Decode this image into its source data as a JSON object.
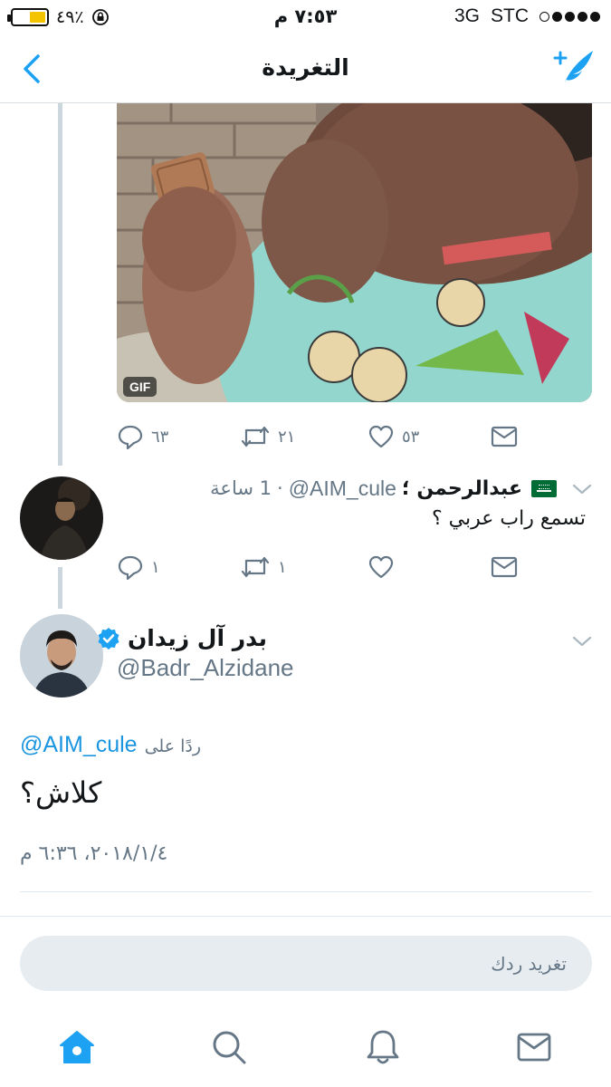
{
  "status_bar": {
    "battery_percent": "٤٩٪",
    "battery_level": 0.49,
    "time": "٧:٥٣ م",
    "network": "3G",
    "carrier": "STC"
  },
  "nav": {
    "title": "التغريدة"
  },
  "previous_tweet": {
    "media_badge": "GIF",
    "reply_count": "٦٣",
    "retweet_count": "٢١",
    "like_count": "٥٣"
  },
  "reply_tweet": {
    "name": "عبدالرحمن ؛",
    "handle": "@AIM_cule",
    "time": "1 ساعة",
    "separator": "·",
    "text": "تسمع راب عربي ؟",
    "reply_count": "١",
    "retweet_count": "١"
  },
  "main_tweet": {
    "name": "بدر آل زيدان",
    "handle": "@Badr_Alzidane",
    "replying_to_label": "ردًا على",
    "replying_to_handle": "@AIM_cule",
    "text": "كلاش؟",
    "timestamp": "٢٠١٨/١/٤، ٦:٣٦ م"
  },
  "composer": {
    "placeholder": "تغريد ردك"
  },
  "colors": {
    "accent": "#1da1f2",
    "secondary_text": "#657786",
    "thread_line": "#ccd6dd"
  },
  "icons": [
    "back-chevron-icon",
    "compose-tweet-icon",
    "reply-icon",
    "retweet-icon",
    "like-icon",
    "direct-message-icon",
    "home-icon",
    "search-icon",
    "notifications-icon",
    "messages-icon",
    "verified-icon",
    "chevron-down-icon"
  ]
}
